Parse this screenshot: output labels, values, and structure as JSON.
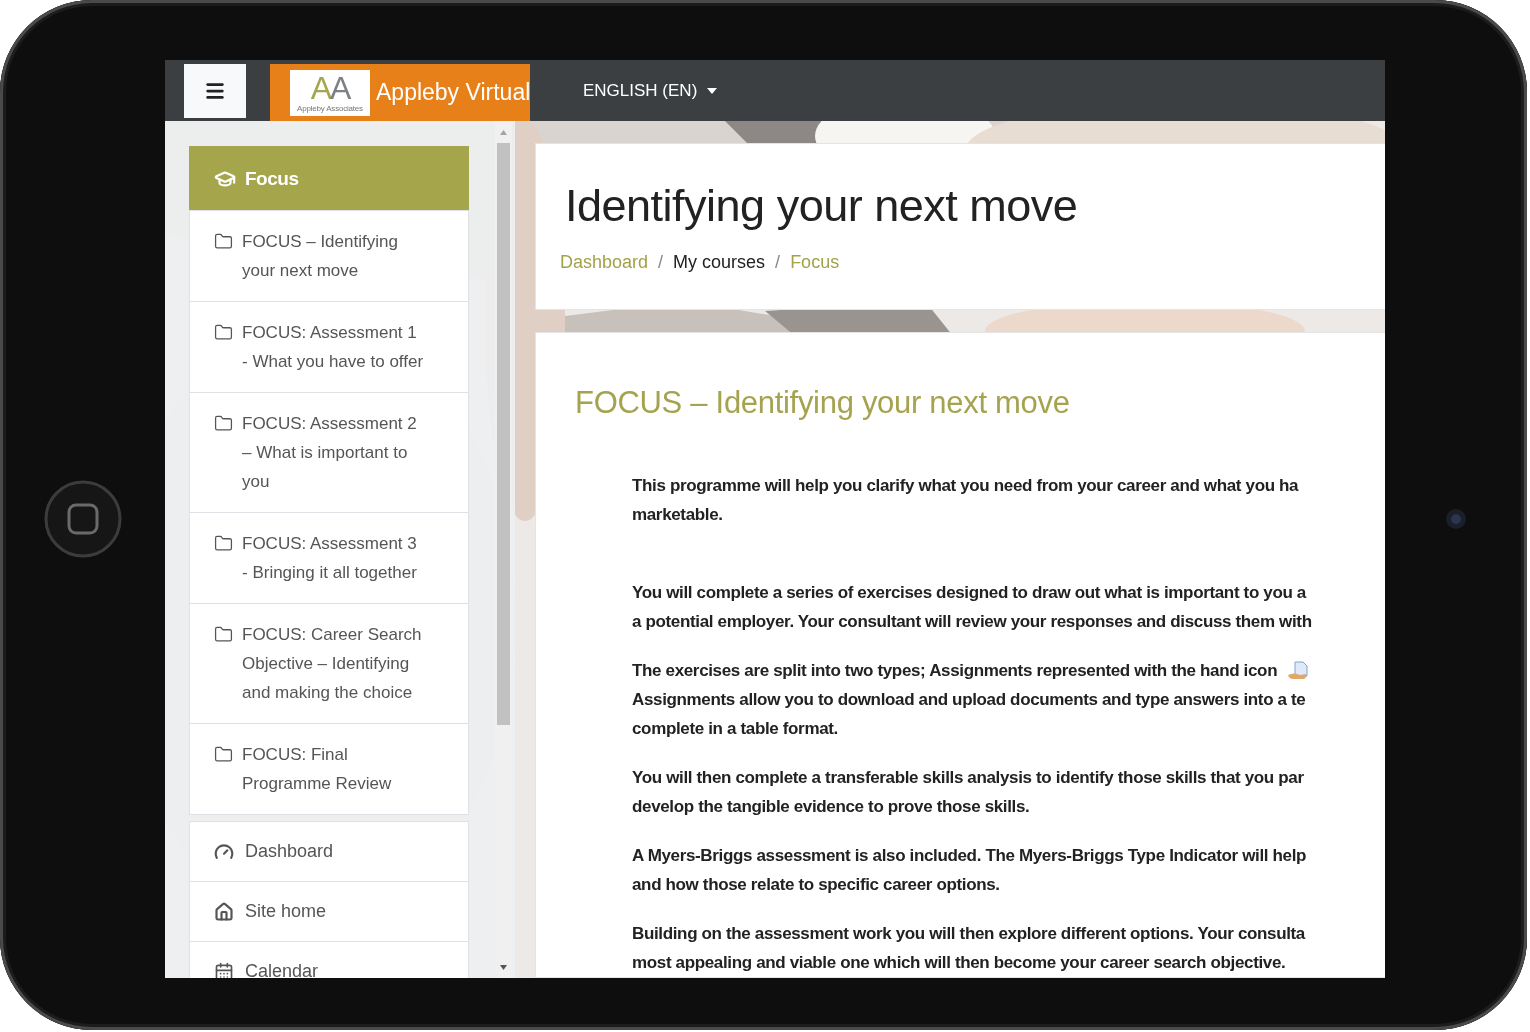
{
  "navbar": {
    "brand": {
      "logo_letters": [
        {
          "text": "A",
          "color": "#a5a64b"
        },
        {
          "text": "A",
          "color": "#7d8084"
        }
      ],
      "logo_tagline": "Appleby Associates",
      "name": "Appleby Virtual"
    },
    "language": "ENGLISH (EN)"
  },
  "sidebar": {
    "course_items": [
      {
        "kind": "course",
        "label": "Focus",
        "selected": true
      },
      {
        "kind": "section",
        "label": "FOCUS – Identifying your next move",
        "selected": false
      },
      {
        "kind": "section",
        "label": "FOCUS: Assessment 1 - What you have to offer",
        "selected": false
      },
      {
        "kind": "section",
        "label": "FOCUS: Assessment 2 – What is important to you",
        "selected": false
      },
      {
        "kind": "section",
        "label": "FOCUS: Assessment 3 - Bringing it all together",
        "selected": false
      },
      {
        "kind": "section",
        "label": "FOCUS: Career Search Objective – Identifying and making the choice",
        "selected": false
      },
      {
        "kind": "section",
        "label": "FOCUS: Final Programme Review",
        "selected": false
      }
    ],
    "nav_items": [
      {
        "label": "Dashboard"
      },
      {
        "label": "Site home"
      },
      {
        "label": "Calendar"
      }
    ]
  },
  "header": {
    "title": "Identifying your next move",
    "breadcrumb_separator": "/",
    "breadcrumbs": [
      {
        "label": "Dashboard",
        "link": true
      },
      {
        "label": "My courses",
        "link": false
      },
      {
        "label": "Focus",
        "link": true
      }
    ]
  },
  "section": {
    "title": "FOCUS – Identifying your next move",
    "paragraphs": [
      {
        "lines": [
          {
            "text": "This programme will help you clarify what you need from your career and what you ha"
          },
          {
            "text": "marketable."
          }
        ]
      },
      {
        "lines": [
          {
            "text": "You will complete a series of exercises designed to draw out what is important to you a"
          },
          {
            "text": "a potential employer. Your consultant will review your responses and discuss them with"
          }
        ]
      },
      {
        "lines": [
          {
            "text": "The exercises are split into two types; Assignments represented with the hand icon",
            "hand_icon": true
          },
          {
            "text": "Assignments allow you to download and upload documents and type answers into a te"
          },
          {
            "text": "complete in a table format."
          }
        ]
      },
      {
        "lines": [
          {
            "text": "You will then complete a transferable skills analysis to identify those skills that you par"
          },
          {
            "text": "develop the tangible evidence to prove those skills."
          }
        ]
      },
      {
        "lines": [
          {
            "text": "A Myers-Briggs assessment is also included. The Myers-Briggs Type Indicator will help"
          },
          {
            "text": "and how those relate to specific career options."
          }
        ]
      },
      {
        "lines": [
          {
            "text": "Building on the assessment work you will then explore different options. Your consulta"
          },
          {
            "text": "most appealing and viable one which will then become your career search objective."
          }
        ]
      }
    ]
  }
}
